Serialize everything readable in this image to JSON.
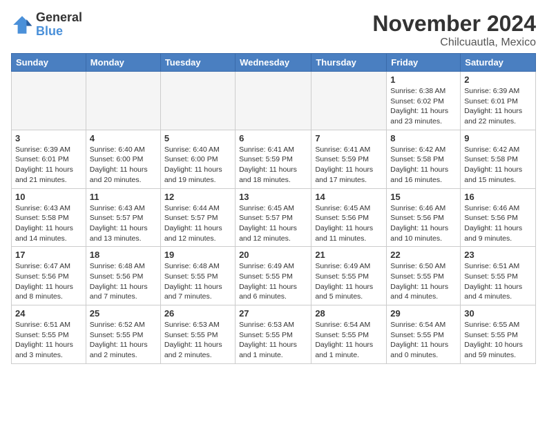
{
  "logo": {
    "general": "General",
    "blue": "Blue"
  },
  "header": {
    "month": "November 2024",
    "location": "Chilcuautla, Mexico"
  },
  "weekdays": [
    "Sunday",
    "Monday",
    "Tuesday",
    "Wednesday",
    "Thursday",
    "Friday",
    "Saturday"
  ],
  "weeks": [
    [
      {
        "day": "",
        "empty": true
      },
      {
        "day": "",
        "empty": true
      },
      {
        "day": "",
        "empty": true
      },
      {
        "day": "",
        "empty": true
      },
      {
        "day": "",
        "empty": true
      },
      {
        "day": "1",
        "sunrise": "6:38 AM",
        "sunset": "6:02 PM",
        "daylight": "11 hours and 23 minutes."
      },
      {
        "day": "2",
        "sunrise": "6:39 AM",
        "sunset": "6:01 PM",
        "daylight": "11 hours and 22 minutes."
      }
    ],
    [
      {
        "day": "3",
        "sunrise": "6:39 AM",
        "sunset": "6:01 PM",
        "daylight": "11 hours and 21 minutes."
      },
      {
        "day": "4",
        "sunrise": "6:40 AM",
        "sunset": "6:00 PM",
        "daylight": "11 hours and 20 minutes."
      },
      {
        "day": "5",
        "sunrise": "6:40 AM",
        "sunset": "6:00 PM",
        "daylight": "11 hours and 19 minutes."
      },
      {
        "day": "6",
        "sunrise": "6:41 AM",
        "sunset": "5:59 PM",
        "daylight": "11 hours and 18 minutes."
      },
      {
        "day": "7",
        "sunrise": "6:41 AM",
        "sunset": "5:59 PM",
        "daylight": "11 hours and 17 minutes."
      },
      {
        "day": "8",
        "sunrise": "6:42 AM",
        "sunset": "5:58 PM",
        "daylight": "11 hours and 16 minutes."
      },
      {
        "day": "9",
        "sunrise": "6:42 AM",
        "sunset": "5:58 PM",
        "daylight": "11 hours and 15 minutes."
      }
    ],
    [
      {
        "day": "10",
        "sunrise": "6:43 AM",
        "sunset": "5:58 PM",
        "daylight": "11 hours and 14 minutes."
      },
      {
        "day": "11",
        "sunrise": "6:43 AM",
        "sunset": "5:57 PM",
        "daylight": "11 hours and 13 minutes."
      },
      {
        "day": "12",
        "sunrise": "6:44 AM",
        "sunset": "5:57 PM",
        "daylight": "11 hours and 12 minutes."
      },
      {
        "day": "13",
        "sunrise": "6:45 AM",
        "sunset": "5:57 PM",
        "daylight": "11 hours and 12 minutes."
      },
      {
        "day": "14",
        "sunrise": "6:45 AM",
        "sunset": "5:56 PM",
        "daylight": "11 hours and 11 minutes."
      },
      {
        "day": "15",
        "sunrise": "6:46 AM",
        "sunset": "5:56 PM",
        "daylight": "11 hours and 10 minutes."
      },
      {
        "day": "16",
        "sunrise": "6:46 AM",
        "sunset": "5:56 PM",
        "daylight": "11 hours and 9 minutes."
      }
    ],
    [
      {
        "day": "17",
        "sunrise": "6:47 AM",
        "sunset": "5:56 PM",
        "daylight": "11 hours and 8 minutes."
      },
      {
        "day": "18",
        "sunrise": "6:48 AM",
        "sunset": "5:56 PM",
        "daylight": "11 hours and 7 minutes."
      },
      {
        "day": "19",
        "sunrise": "6:48 AM",
        "sunset": "5:55 PM",
        "daylight": "11 hours and 7 minutes."
      },
      {
        "day": "20",
        "sunrise": "6:49 AM",
        "sunset": "5:55 PM",
        "daylight": "11 hours and 6 minutes."
      },
      {
        "day": "21",
        "sunrise": "6:49 AM",
        "sunset": "5:55 PM",
        "daylight": "11 hours and 5 minutes."
      },
      {
        "day": "22",
        "sunrise": "6:50 AM",
        "sunset": "5:55 PM",
        "daylight": "11 hours and 4 minutes."
      },
      {
        "day": "23",
        "sunrise": "6:51 AM",
        "sunset": "5:55 PM",
        "daylight": "11 hours and 4 minutes."
      }
    ],
    [
      {
        "day": "24",
        "sunrise": "6:51 AM",
        "sunset": "5:55 PM",
        "daylight": "11 hours and 3 minutes."
      },
      {
        "day": "25",
        "sunrise": "6:52 AM",
        "sunset": "5:55 PM",
        "daylight": "11 hours and 2 minutes."
      },
      {
        "day": "26",
        "sunrise": "6:53 AM",
        "sunset": "5:55 PM",
        "daylight": "11 hours and 2 minutes."
      },
      {
        "day": "27",
        "sunrise": "6:53 AM",
        "sunset": "5:55 PM",
        "daylight": "11 hours and 1 minute."
      },
      {
        "day": "28",
        "sunrise": "6:54 AM",
        "sunset": "5:55 PM",
        "daylight": "11 hours and 1 minute."
      },
      {
        "day": "29",
        "sunrise": "6:54 AM",
        "sunset": "5:55 PM",
        "daylight": "11 hours and 0 minutes."
      },
      {
        "day": "30",
        "sunrise": "6:55 AM",
        "sunset": "5:55 PM",
        "daylight": "10 hours and 59 minutes."
      }
    ]
  ]
}
